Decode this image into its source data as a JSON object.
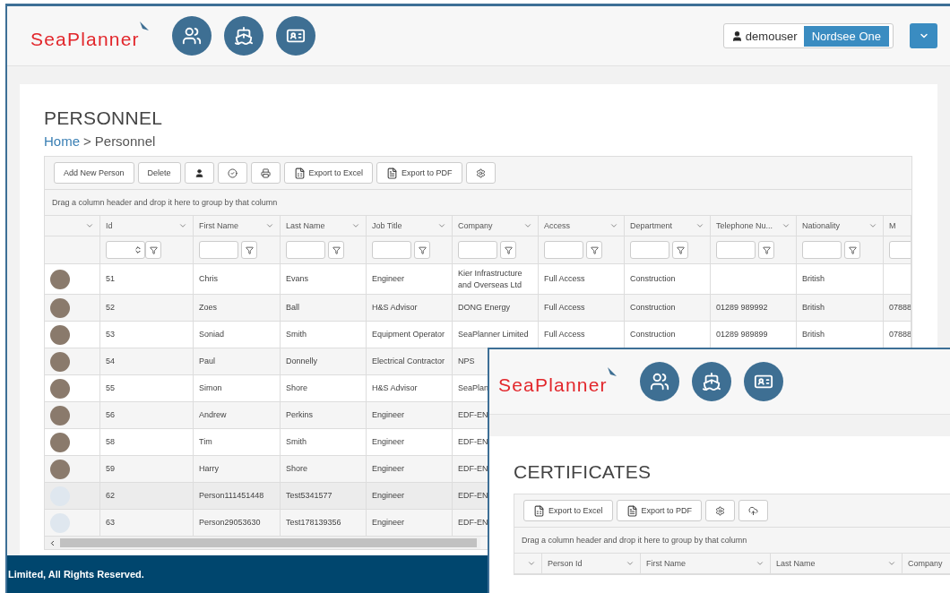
{
  "app": {
    "logo": "SeaPlanner",
    "user": "demouser",
    "site": "Nordsee One"
  },
  "nav_icons": [
    {
      "kind": "people"
    },
    {
      "kind": "ship"
    },
    {
      "kind": "card"
    }
  ],
  "personnel": {
    "title": "PERSONNEL",
    "breadcrumb": {
      "home": "Home",
      "separator": ">",
      "current": "Personnel"
    },
    "toolbar": [
      {
        "kind": "text",
        "label": "Add New Person"
      },
      {
        "kind": "text",
        "label": "Delete"
      },
      {
        "kind": "user"
      },
      {
        "kind": "check"
      },
      {
        "kind": "print"
      },
      {
        "kind": "excel",
        "label": "Export to Excel"
      },
      {
        "kind": "pdf",
        "label": "Export to PDF"
      },
      {
        "kind": "settings"
      }
    ],
    "group_hint": "Drag a column header and drop it here to group by that column",
    "columns": [
      {
        "label": "Id",
        "spinner": true
      },
      {
        "label": "First Name",
        "spinner": false
      },
      {
        "label": "Last Name",
        "spinner": false
      },
      {
        "label": "Job Title",
        "spinner": false
      },
      {
        "label": "Company",
        "spinner": false
      },
      {
        "label": "Access",
        "spinner": false
      },
      {
        "label": "Department",
        "spinner": false
      },
      {
        "label": "Telephone Nu...",
        "spinner": false
      },
      {
        "label": "Nationality",
        "spinner": false
      },
      {
        "label": "M"
      }
    ],
    "rows": [
      {
        "photo": true,
        "cells": [
          "51",
          "Chris",
          "Evans",
          "Engineer",
          "Kier Infrastructure and Overseas Ltd",
          "Full Access",
          "Construction",
          "",
          "British",
          ""
        ]
      },
      {
        "photo": true,
        "cells": [
          "52",
          "Zoes",
          "Ball",
          "H&S Advisor",
          "DONG Energy",
          "Full Access",
          "Construction",
          "01289 989992",
          "British",
          "07888"
        ]
      },
      {
        "photo": true,
        "cells": [
          "53",
          "Soniad",
          "Smith",
          "Equipment Operator",
          "SeaPlanner Limited",
          "Full Access",
          "Construction",
          "01289 989899",
          "British",
          "07888"
        ]
      },
      {
        "photo": true,
        "cells": [
          "54",
          "Paul",
          "Donnelly",
          "Electrical Contractor",
          "NPS"
        ]
      },
      {
        "photo": true,
        "cells": [
          "55",
          "Simon",
          "Shore",
          "H&S Advisor",
          "SeaPlan"
        ]
      },
      {
        "photo": true,
        "cells": [
          "56",
          "Andrew",
          "Perkins",
          "Engineer",
          "EDF-EN"
        ]
      },
      {
        "photo": true,
        "cells": [
          "58",
          "Tim",
          "Smith",
          "Engineer",
          "EDF-EN"
        ]
      },
      {
        "photo": true,
        "cells": [
          "59",
          "Harry",
          "Shore",
          "Engineer",
          "EDF-EN"
        ]
      },
      {
        "photo": false,
        "cells": [
          "62",
          "Person111451448",
          "Test5341577",
          "Engineer",
          "EDF-EN"
        ]
      },
      {
        "photo": false,
        "cells": [
          "63",
          "Person29053630",
          "Test178139356",
          "Engineer",
          "EDF-EN"
        ]
      }
    ]
  },
  "footer": "Limited, All Rights Reserved.",
  "certificates": {
    "logo": "SeaPlanner",
    "nav_icons": [
      {
        "kind": "people"
      },
      {
        "kind": "ship"
      },
      {
        "kind": "card"
      }
    ],
    "title": "CERTIFICATES",
    "toolbar": [
      {
        "kind": "excel",
        "label": "Export to Excel"
      },
      {
        "kind": "pdf",
        "label": "Export to PDF"
      },
      {
        "kind": "settings"
      },
      {
        "kind": "upload"
      }
    ],
    "group_hint": "Drag a column header and drop it here to group by that column",
    "columns": [
      {
        "label": "Person Id"
      },
      {
        "label": "First Name"
      },
      {
        "label": "Last Name"
      },
      {
        "label": "Company"
      }
    ]
  }
}
